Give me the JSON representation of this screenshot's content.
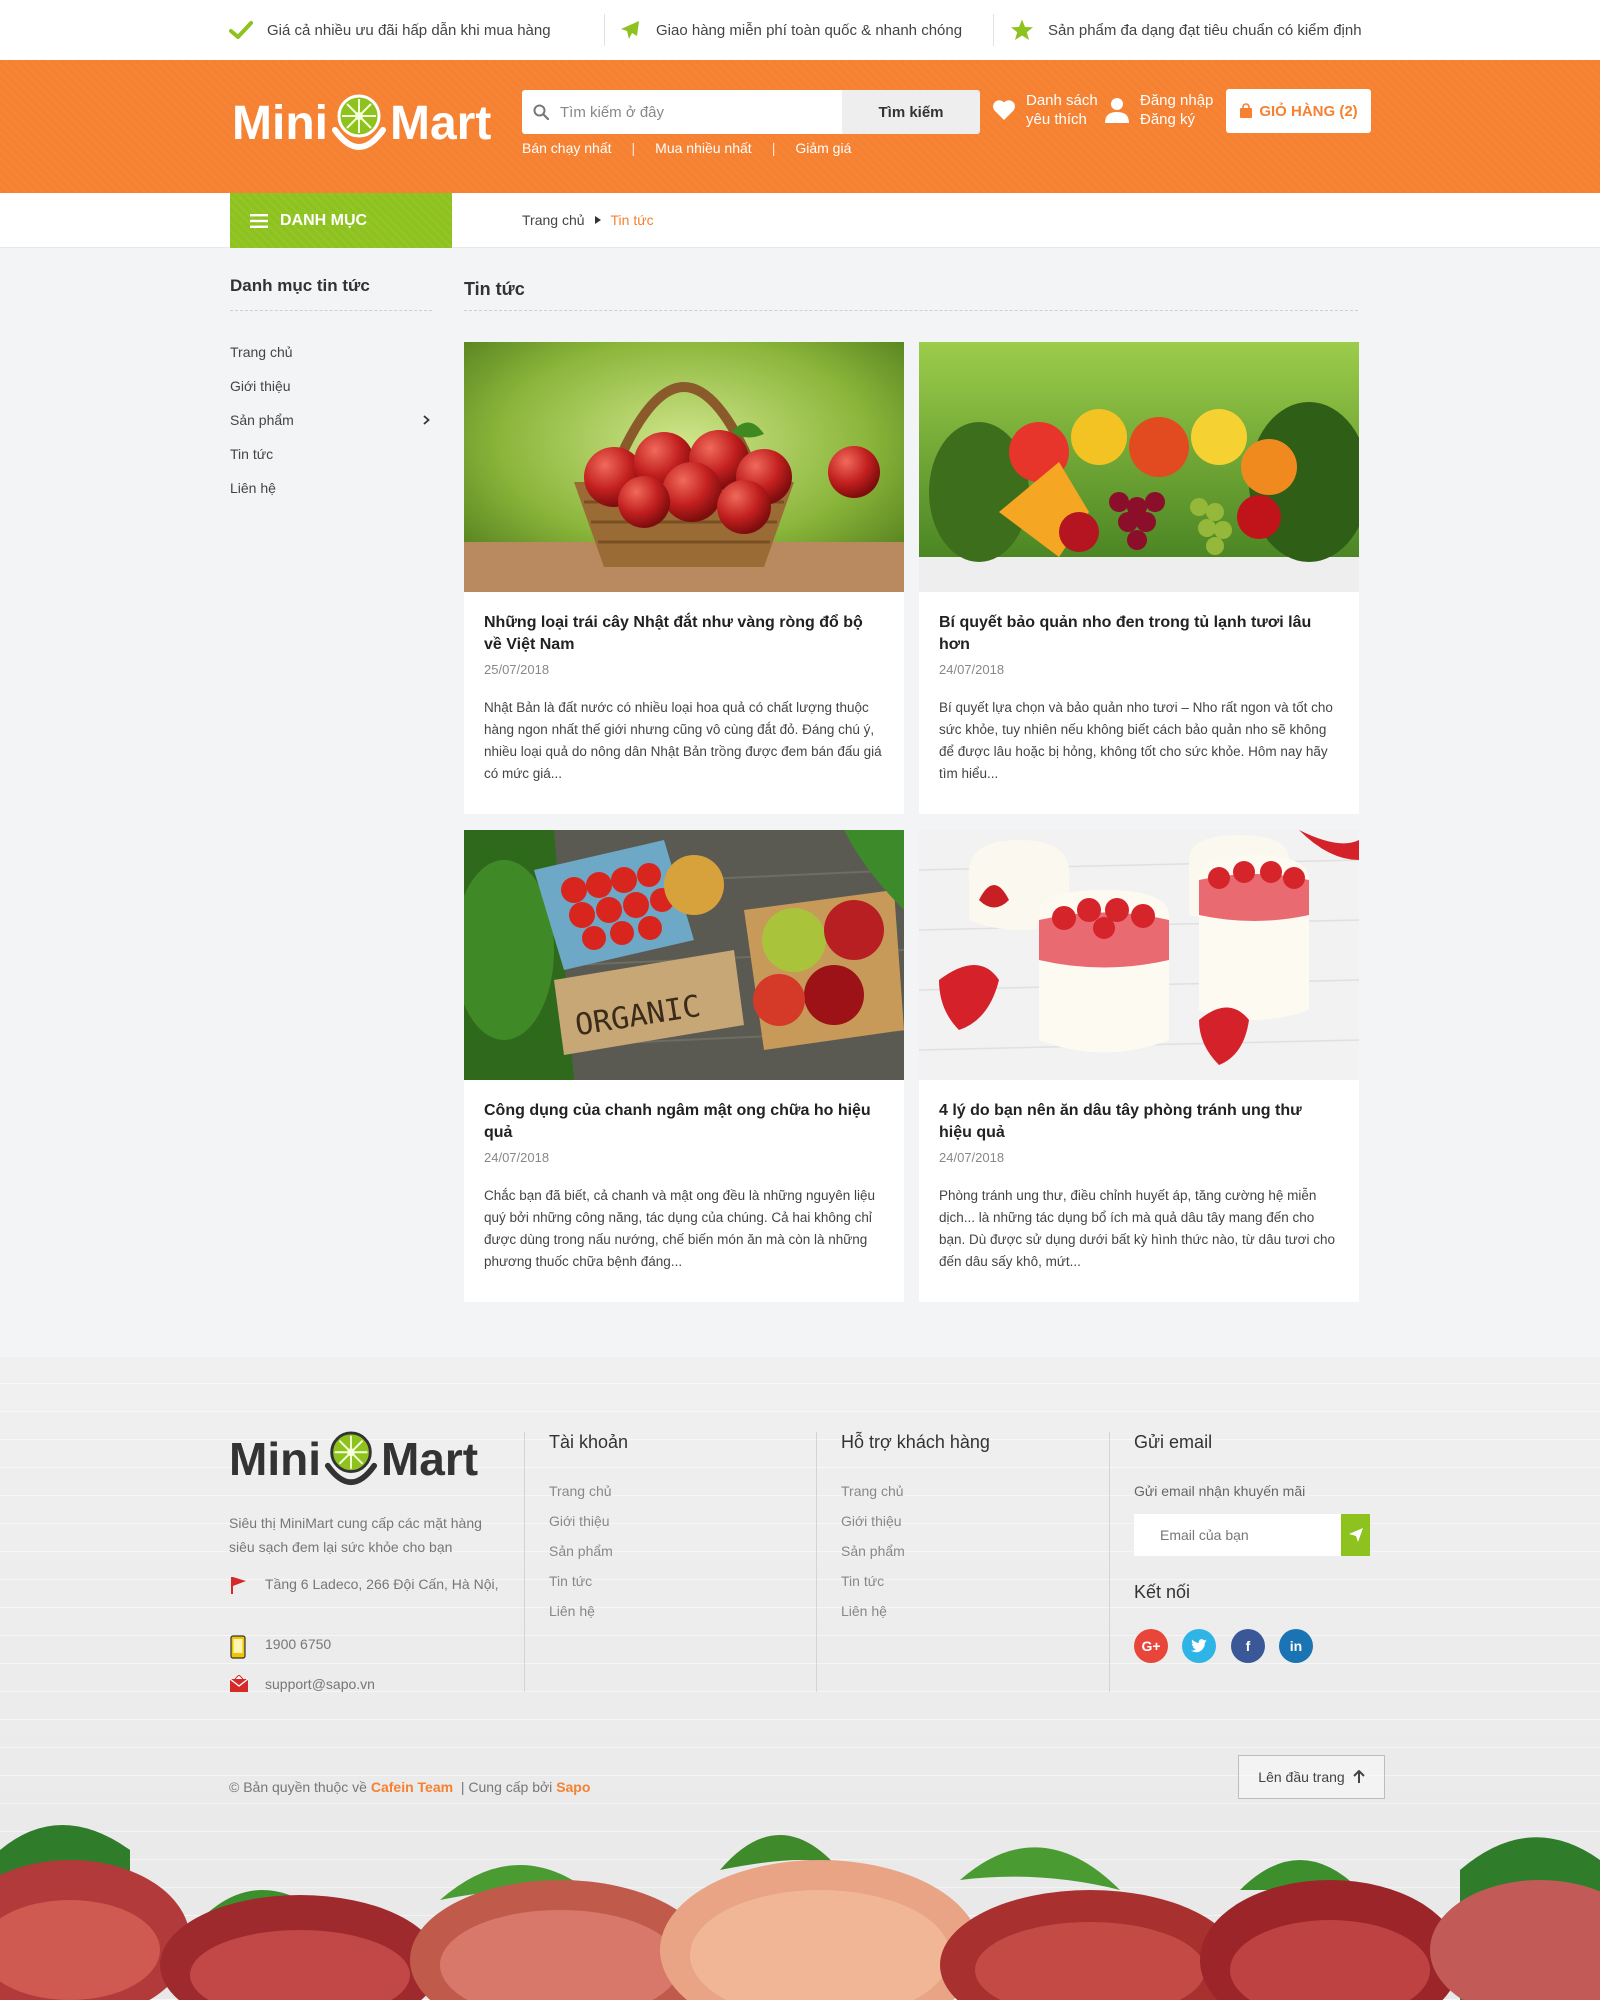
{
  "topbar": {
    "items": [
      {
        "icon": "check-icon",
        "text": "Giá cả nhiều ưu đãi hấp dẫn khi mua hàng"
      },
      {
        "icon": "plane-icon",
        "text": "Giao hàng miễn phí toàn quốc & nhanh chóng"
      },
      {
        "icon": "star-icon",
        "text": "Sản phẩm đa dạng đạt tiêu chuẩn có kiểm định"
      }
    ]
  },
  "header": {
    "logo_left": "Mini",
    "logo_right": "Mart",
    "search_placeholder": "Tìm kiếm ở đây",
    "search_button": "Tìm kiếm",
    "quick_links": [
      "Bán chạy nhất",
      "Mua nhiều nhất",
      "Giảm giá"
    ],
    "wishlist_line1": "Danh sách",
    "wishlist_line2": "yêu thích",
    "login": "Đăng nhập",
    "register": "Đăng ký",
    "cart_label": "GIỎ HÀNG (2)"
  },
  "catbar": {
    "menu_label": "DANH MỤC",
    "breadcrumb_home": "Trang chủ",
    "breadcrumb_current": "Tin tức"
  },
  "sidebar": {
    "title": "Danh mục tin tức",
    "items": [
      "Trang chủ",
      "Giới thiệu",
      "Sản phẩm",
      "Tin tức",
      "Liên hệ"
    ]
  },
  "main": {
    "title": "Tin tức",
    "articles": [
      {
        "image": "apple-basket-photo",
        "title": "Những loại trái cây Nhật đắt như vàng ròng đổ bộ về Việt Nam",
        "date": "25/07/2018",
        "excerpt": "Nhật Bản là đất nước có nhiều loại hoa quả có chất lượng thuộc hàng ngon nhất thế giới nhưng cũng vô cùng đắt đỏ. Đáng chú ý, nhiều loại quả do nông dân Nhật Bản trồng được đem bán đấu giá có mức giá..."
      },
      {
        "image": "mixed-fruits-photo",
        "title": "Bí quyết bảo quản nho đen trong tủ lạnh tươi lâu hơn",
        "date": "24/07/2018",
        "excerpt": "Bí quyết lựa chọn và bảo quản nho tươi – Nho rất ngon và tốt cho sức khỏe, tuy nhiên nếu không biết cách bảo quản nho sẽ không để được lâu hoặc bị hỏng, không tốt cho sức khỏe. Hôm nay hãy tìm hiểu..."
      },
      {
        "image": "organic-vegetables-photo",
        "title": "Công dụng của chanh ngâm mật ong chữa ho hiệu quả",
        "date": "24/07/2018",
        "excerpt": "Chắc bạn đã biết, cả chanh và mật ong đều là những nguyên liệu quý bởi những công năng, tác dụng của chúng. Cả hai không chỉ được dùng trong nấu nướng, chế biến món ăn mà còn là những phương thuốc chữa bệnh đáng..."
      },
      {
        "image": "strawberry-yogurt-photo",
        "title": "4 lý do bạn nên ăn dâu tây phòng tránh ung thư hiệu quả",
        "date": "24/07/2018",
        "excerpt": "Phòng tránh ung thư, điều chỉnh huyết áp, tăng cường hệ miễn dịch... là những tác dụng bổ ích mà quả dâu tây mang đến cho bạn. Dù được sử dụng dưới bất kỳ hình thức nào, từ dâu tươi cho đến dâu sấy khô, mứt..."
      }
    ]
  },
  "footer": {
    "description": "Siêu thị MiniMart cung cấp các mặt hàng siêu sạch đem lại sức khỏe cho bạn",
    "address": "Tầng 6 Ladeco, 266 Đội Cấn, Hà Nội,",
    "phone": "1900 6750",
    "email": "support@sapo.vn",
    "col_account": {
      "title": "Tài khoản",
      "links": [
        "Trang chủ",
        "Giới thiệu",
        "Sản phẩm",
        "Tin tức",
        "Liên hệ"
      ]
    },
    "col_support": {
      "title": "Hỗ trợ khách hàng",
      "links": [
        "Trang chủ",
        "Giới thiệu",
        "Sản phẩm",
        "Tin tức",
        "Liên hệ"
      ]
    },
    "newsletter_title": "Gửi email",
    "newsletter_sub": "Gửi email nhận khuyến mãi",
    "newsletter_placeholder": "Email của bạn",
    "connect_title": "Kết nối",
    "social": [
      {
        "name": "google-plus",
        "label": "G+",
        "color": "#e8463a"
      },
      {
        "name": "twitter",
        "label": "t",
        "color": "#2fb4e6"
      },
      {
        "name": "facebook",
        "label": "f",
        "color": "#3a5897"
      },
      {
        "name": "linkedin",
        "label": "in",
        "color": "#1a74b3"
      }
    ],
    "copyright_prefix": "© Bản quyền thuộc về",
    "copyright_team": "Cafein Team",
    "copyright_sep": "|  Cung cấp bởi",
    "copyright_provider": "Sapo",
    "back_to_top": "Lên đầu trang"
  },
  "colors": {
    "brand_orange": "#f58131",
    "brand_green": "#8dc21f"
  }
}
